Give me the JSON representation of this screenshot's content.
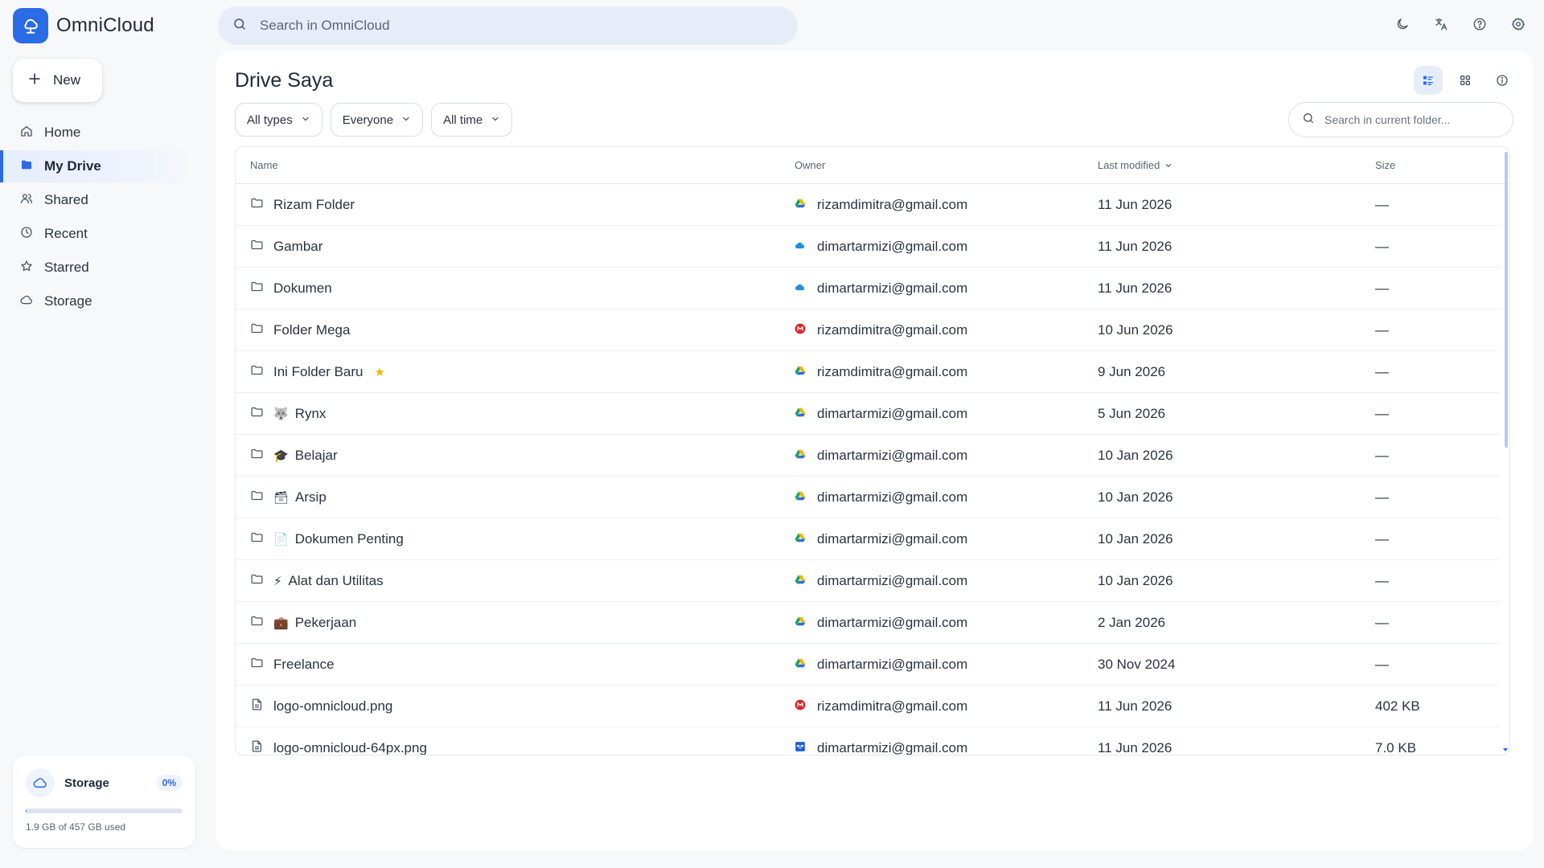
{
  "app": {
    "name": "OmniCloud",
    "search_placeholder": "Search in OmniCloud"
  },
  "topbar_icons": [
    "moon-icon",
    "translate-icon",
    "help-icon",
    "settings-icon"
  ],
  "sidebar": {
    "new_label": "New",
    "items": [
      {
        "label": "Home",
        "icon": "home-icon",
        "active": false
      },
      {
        "label": "My Drive",
        "icon": "folder-icon",
        "active": true
      },
      {
        "label": "Shared",
        "icon": "users-icon",
        "active": false
      },
      {
        "label": "Recent",
        "icon": "clock-icon",
        "active": false
      },
      {
        "label": "Starred",
        "icon": "star-icon",
        "active": false
      },
      {
        "label": "Storage",
        "icon": "cloud-icon",
        "active": false
      }
    ],
    "storage": {
      "title": "Storage",
      "percent": "0%",
      "used_fraction": 0.004,
      "used_text": "1.9 GB of 457 GB used"
    }
  },
  "main": {
    "title": "Drive Saya",
    "filters": [
      "All types",
      "Everyone",
      "All time"
    ],
    "folder_search_placeholder": "Search in current folder...",
    "columns": {
      "name": "Name",
      "owner": "Owner",
      "modified": "Last modified",
      "size": "Size"
    },
    "rows": [
      {
        "kind": "folder",
        "emoji": "",
        "name": "Rizam Folder",
        "starred": false,
        "provider": "gdrive",
        "owner": "rizamdimitra@gmail.com",
        "modified": "11 Jun 2026",
        "size": "—"
      },
      {
        "kind": "folder",
        "emoji": "",
        "name": "Gambar",
        "starred": false,
        "provider": "onedrive",
        "owner": "dimartarmizi@gmail.com",
        "modified": "11 Jun 2026",
        "size": "—"
      },
      {
        "kind": "folder",
        "emoji": "",
        "name": "Dokumen",
        "starred": false,
        "provider": "onedrive",
        "owner": "dimartarmizi@gmail.com",
        "modified": "11 Jun 2026",
        "size": "—"
      },
      {
        "kind": "folder",
        "emoji": "",
        "name": "Folder Mega",
        "starred": false,
        "provider": "mega",
        "owner": "rizamdimitra@gmail.com",
        "modified": "10 Jun 2026",
        "size": "—"
      },
      {
        "kind": "folder",
        "emoji": "",
        "name": "Ini Folder Baru",
        "starred": true,
        "provider": "gdrive",
        "owner": "rizamdimitra@gmail.com",
        "modified": "9 Jun 2026",
        "size": "—"
      },
      {
        "kind": "folder",
        "emoji": "🐺",
        "name": "Rynx",
        "starred": false,
        "provider": "gdrive",
        "owner": "dimartarmizi@gmail.com",
        "modified": "5 Jun 2026",
        "size": "—"
      },
      {
        "kind": "folder",
        "emoji": "🎓",
        "name": "Belajar",
        "starred": false,
        "provider": "gdrive",
        "owner": "dimartarmizi@gmail.com",
        "modified": "10 Jan 2026",
        "size": "—"
      },
      {
        "kind": "folder",
        "emoji": "🗃",
        "name": "Arsip",
        "starred": false,
        "provider": "gdrive",
        "owner": "dimartarmizi@gmail.com",
        "modified": "10 Jan 2026",
        "size": "—"
      },
      {
        "kind": "folder",
        "emoji": "📄",
        "name": "Dokumen Penting",
        "starred": false,
        "provider": "gdrive",
        "owner": "dimartarmizi@gmail.com",
        "modified": "10 Jan 2026",
        "size": "—"
      },
      {
        "kind": "folder",
        "emoji": "⚡",
        "name": "Alat dan Utilitas",
        "starred": false,
        "provider": "gdrive",
        "owner": "dimartarmizi@gmail.com",
        "modified": "10 Jan 2026",
        "size": "—"
      },
      {
        "kind": "folder",
        "emoji": "💼",
        "name": "Pekerjaan",
        "starred": false,
        "provider": "gdrive",
        "owner": "dimartarmizi@gmail.com",
        "modified": "2 Jan 2026",
        "size": "—"
      },
      {
        "kind": "folder",
        "emoji": "",
        "name": "Freelance",
        "starred": false,
        "provider": "gdrive",
        "owner": "dimartarmizi@gmail.com",
        "modified": "30 Nov 2024",
        "size": "—"
      },
      {
        "kind": "file",
        "emoji": "",
        "name": "logo-omnicloud.png",
        "starred": false,
        "provider": "mega",
        "owner": "rizamdimitra@gmail.com",
        "modified": "11 Jun 2026",
        "size": "402 KB"
      },
      {
        "kind": "file",
        "emoji": "",
        "name": "logo-omnicloud-64px.png",
        "starred": false,
        "provider": "dropbox",
        "owner": "dimartarmizi@gmail.com",
        "modified": "11 Jun 2026",
        "size": "7.0 KB"
      }
    ]
  },
  "colors": {
    "accent": "#2b6be6",
    "star": "#f5b400",
    "mega": "#d9272e",
    "onedrive": "#1e8fe1"
  }
}
